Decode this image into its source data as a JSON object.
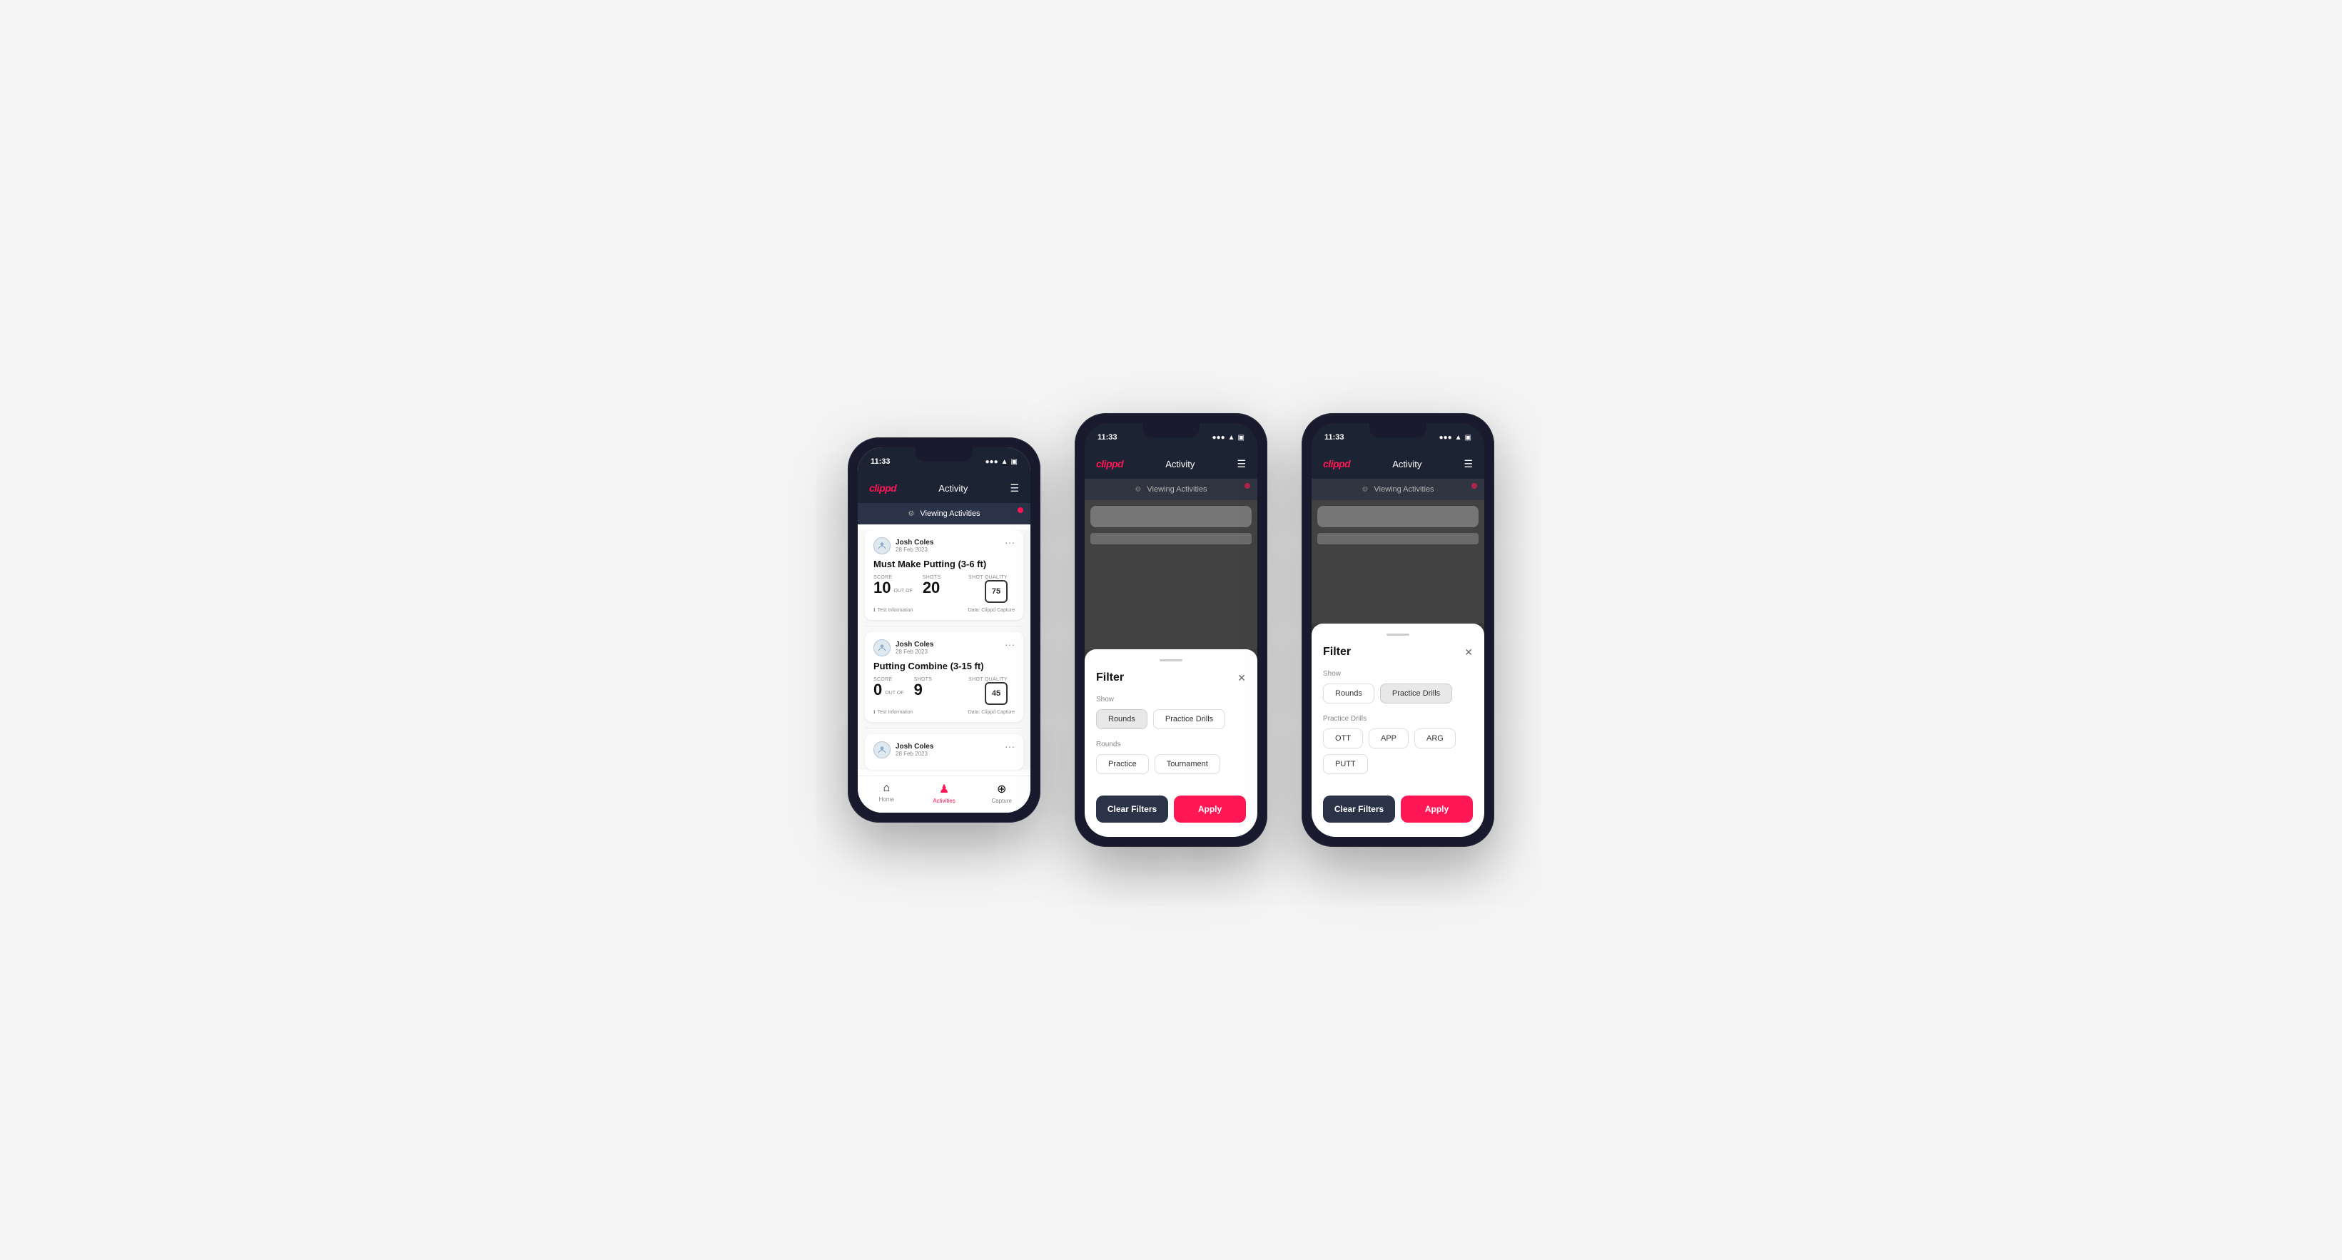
{
  "phones": [
    {
      "id": "phone1",
      "type": "activity-list",
      "status": {
        "time": "11:33",
        "signal": "●●●",
        "wifi": "WiFi",
        "battery": "51"
      },
      "header": {
        "logo": "clippd",
        "title": "Activity",
        "menu_icon": "☰"
      },
      "viewing_bar": {
        "icon": "⚙",
        "text": "Viewing Activities"
      },
      "activities": [
        {
          "user": "Josh Coles",
          "date": "28 Feb 2023",
          "title": "Must Make Putting (3-6 ft)",
          "score_label": "Score",
          "score": "10",
          "out_of_label": "OUT OF",
          "shots_label": "Shots",
          "shots": "20",
          "shot_quality_label": "Shot Quality",
          "shot_quality": "75",
          "test_info": "Test Information",
          "data_source": "Data: Clippd Capture"
        },
        {
          "user": "Josh Coles",
          "date": "28 Feb 2023",
          "title": "Putting Combine (3-15 ft)",
          "score_label": "Score",
          "score": "0",
          "out_of_label": "OUT OF",
          "shots_label": "Shots",
          "shots": "9",
          "shot_quality_label": "Shot Quality",
          "shot_quality": "45",
          "test_info": "Test Information",
          "data_source": "Data: Clippd Capture"
        },
        {
          "user": "Josh Coles",
          "date": "28 Feb 2023",
          "title": "",
          "score": "",
          "shots": "",
          "shot_quality": ""
        }
      ],
      "nav": [
        {
          "label": "Home",
          "icon": "⌂",
          "active": false
        },
        {
          "label": "Activities",
          "icon": "♟",
          "active": true
        },
        {
          "label": "Capture",
          "icon": "⊕",
          "active": false
        }
      ]
    },
    {
      "id": "phone2",
      "type": "filter-rounds",
      "status": {
        "time": "11:33"
      },
      "header": {
        "logo": "clippd",
        "title": "Activity",
        "menu_icon": "☰"
      },
      "viewing_bar": {
        "text": "Viewing Activities"
      },
      "filter": {
        "title": "Filter",
        "show_label": "Show",
        "show_options": [
          {
            "label": "Rounds",
            "active": true
          },
          {
            "label": "Practice Drills",
            "active": false
          }
        ],
        "rounds_label": "Rounds",
        "rounds_options": [
          {
            "label": "Practice",
            "active": false
          },
          {
            "label": "Tournament",
            "active": false
          }
        ],
        "clear_label": "Clear Filters",
        "apply_label": "Apply"
      }
    },
    {
      "id": "phone3",
      "type": "filter-drills",
      "status": {
        "time": "11:33"
      },
      "header": {
        "logo": "clippd",
        "title": "Activity",
        "menu_icon": "☰"
      },
      "viewing_bar": {
        "text": "Viewing Activities"
      },
      "filter": {
        "title": "Filter",
        "show_label": "Show",
        "show_options": [
          {
            "label": "Rounds",
            "active": false
          },
          {
            "label": "Practice Drills",
            "active": true
          }
        ],
        "drills_label": "Practice Drills",
        "drills_options": [
          {
            "label": "OTT",
            "active": false
          },
          {
            "label": "APP",
            "active": false
          },
          {
            "label": "ARG",
            "active": false
          },
          {
            "label": "PUTT",
            "active": false
          }
        ],
        "clear_label": "Clear Filters",
        "apply_label": "Apply"
      }
    }
  ]
}
